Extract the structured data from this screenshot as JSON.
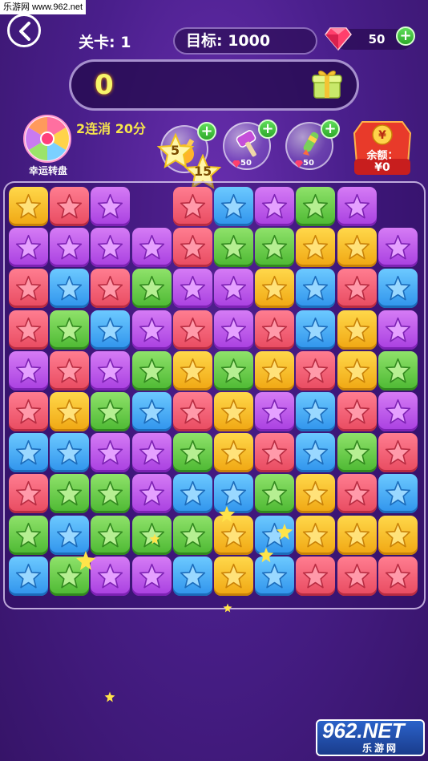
{
  "watermark": {
    "top_text": "乐游网 www.962.net",
    "logo_text": "962.NET",
    "logo_subtext": "乐游网"
  },
  "header": {
    "level_text": "关卡: 1",
    "target_text": "目标: 1000",
    "gems": "50"
  },
  "score": {
    "value": "0"
  },
  "lucky_wheel": {
    "label": "幸运转盘"
  },
  "combo": {
    "text": "2连消 20分"
  },
  "tools": [
    {
      "name": "bomb",
      "cost": ""
    },
    {
      "name": "hammer",
      "cost": "50"
    },
    {
      "name": "rocket",
      "cost": "50"
    }
  ],
  "floating_stars": [
    {
      "value": "5"
    },
    {
      "value": "15"
    }
  ],
  "balance": {
    "label": "余额：",
    "value": "¥0",
    "coin_symbol": "¥"
  },
  "colors": {
    "yellow": "#f6c52a",
    "red": "#f0637a",
    "purple": "#bf5eea",
    "blue": "#47aaf6",
    "green": "#6fcf4c",
    "accent_text": "#f6e44c"
  },
  "board": {
    "rows": [
      [
        "y",
        "r",
        "p",
        "",
        "r",
        "b",
        "p",
        "g",
        "p"
      ],
      [
        "p",
        "p",
        "p",
        "p",
        "r",
        "g",
        "g",
        "y",
        "y",
        "p"
      ],
      [
        "r",
        "b",
        "r",
        "g",
        "p",
        "p",
        "y",
        "b",
        "r",
        "b"
      ],
      [
        "r",
        "g",
        "b",
        "p",
        "r",
        "p",
        "r",
        "b",
        "y",
        "p"
      ],
      [
        "p",
        "r",
        "p",
        "g",
        "y",
        "g",
        "y",
        "r",
        "y",
        "g"
      ],
      [
        "r",
        "y",
        "g",
        "b",
        "r",
        "y",
        "p",
        "b",
        "r",
        "p"
      ],
      [
        "b",
        "b",
        "p",
        "p",
        "g",
        "y",
        "r",
        "b",
        "g",
        "r"
      ],
      [
        "r",
        "g",
        "g",
        "p",
        "b",
        "b",
        "g",
        "y",
        "r",
        "b"
      ],
      [
        "g",
        "b",
        "g",
        "g",
        "g",
        "y",
        "b",
        "y",
        "y",
        "y"
      ],
      [
        "b",
        "g",
        "p",
        "p",
        "b",
        "y",
        "b",
        "r",
        "r",
        "r"
      ]
    ]
  }
}
